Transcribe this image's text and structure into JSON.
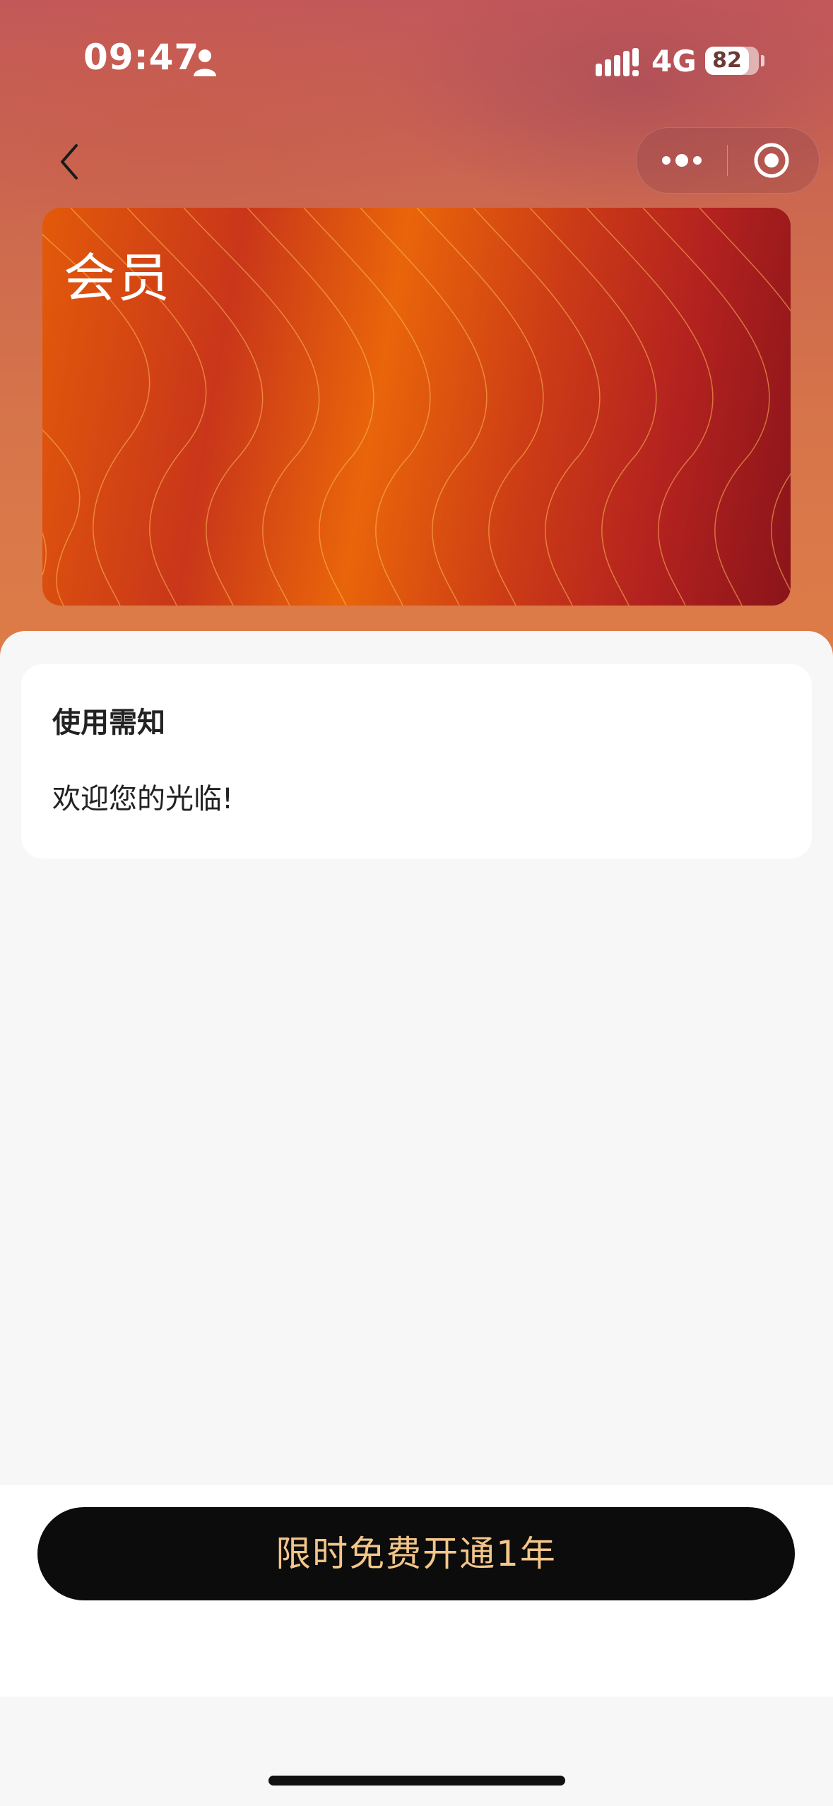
{
  "status_bar": {
    "time": "09:47",
    "network": "4G",
    "battery": "82",
    "battery_level": 0.82
  },
  "nav": {
    "back_icon": "chevron-left-icon",
    "more_icon": "more-dots-icon",
    "close_icon": "target-close-icon"
  },
  "card": {
    "title": "会员"
  },
  "notice": {
    "title": "使用需知",
    "body": "欢迎您的光临!"
  },
  "cta": {
    "label": "限时免费开通1年"
  },
  "colors": {
    "cta_background": "#0c0c0c",
    "cta_text": "#f2c58a",
    "card_orange": "#e9650a",
    "card_red": "#b3221f"
  }
}
